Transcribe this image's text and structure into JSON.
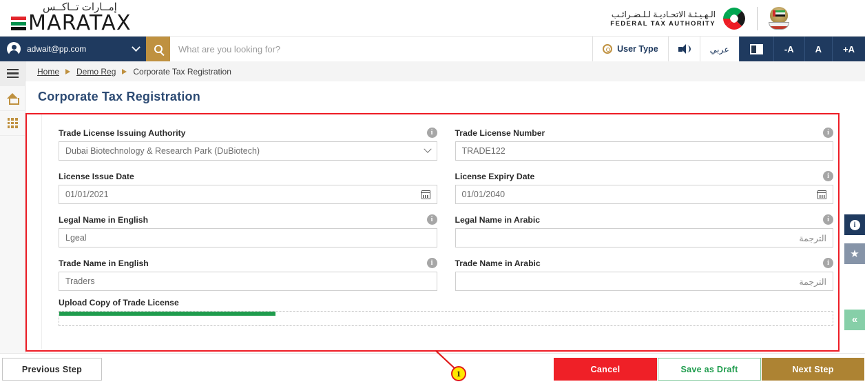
{
  "brand": {
    "logo_arabic": "إمــارات تــاكــس",
    "logo_text": "MARATAX",
    "fta_arabic": "الـهـيـئـة الاتحـاديـة لـلـضـرائـب",
    "fta_english": "FEDERAL TAX AUTHORITY"
  },
  "navbar": {
    "user_email": "adwait@pp.com",
    "search_placeholder": "What are you looking for?",
    "user_type_label": "User Type",
    "arabic_label": "عربي",
    "font_decrease": "-A",
    "font_normal": "A",
    "font_increase": "+A"
  },
  "sidebar": {
    "items": [
      {
        "name": "menu",
        "icon": "hamburger-icon"
      },
      {
        "name": "home",
        "icon": "home-icon"
      },
      {
        "name": "apps",
        "icon": "grid-icon"
      }
    ]
  },
  "breadcrumb": {
    "items": [
      {
        "label": "Home",
        "link": true
      },
      {
        "label": "Demo Reg",
        "link": true
      },
      {
        "label": "Corporate Tax Registration",
        "link": false
      }
    ]
  },
  "page": {
    "title": "Corporate Tax Registration"
  },
  "form": {
    "fields": [
      {
        "label": "Trade License Issuing Authority",
        "value": "Dubai Biotechnology & Research Park (DuBiotech)",
        "control": "select"
      },
      {
        "label": "Trade License Number",
        "value": "TRADE122",
        "control": "text"
      },
      {
        "label": "License Issue Date",
        "value": "01/01/2021",
        "control": "date"
      },
      {
        "label": "License Expiry Date",
        "value": "01/01/2040",
        "control": "date"
      },
      {
        "label": "Legal Name in English",
        "value": "Lgeal",
        "control": "text"
      },
      {
        "label": "Legal Name in Arabic",
        "value": "الترجمة",
        "control": "text-rtl"
      },
      {
        "label": "Trade Name in English",
        "value": "Traders",
        "control": "text"
      },
      {
        "label": "Trade Name in Arabic",
        "value": "الترجمة",
        "control": "text-rtl"
      }
    ],
    "upload": {
      "label": "Upload Copy of Trade License",
      "progress_percent": 28
    }
  },
  "fabs": [
    {
      "name": "info",
      "glyph": "i"
    },
    {
      "name": "favourite",
      "glyph": "★"
    },
    {
      "name": "scroll-top",
      "glyph": "«"
    }
  ],
  "footer": {
    "previous": "Previous Step",
    "cancel": "Cancel",
    "save_draft": "Save as Draft",
    "next": "Next Step"
  },
  "annotation": {
    "badge": "1"
  },
  "colors": {
    "navy": "#1f3a5f",
    "gold": "#bf9140",
    "red": "#ef2027",
    "green": "#1f9c4d",
    "next_gold": "#ad8333",
    "annotation_red": "#ee1c25",
    "annotation_yellow": "#ffe800"
  }
}
